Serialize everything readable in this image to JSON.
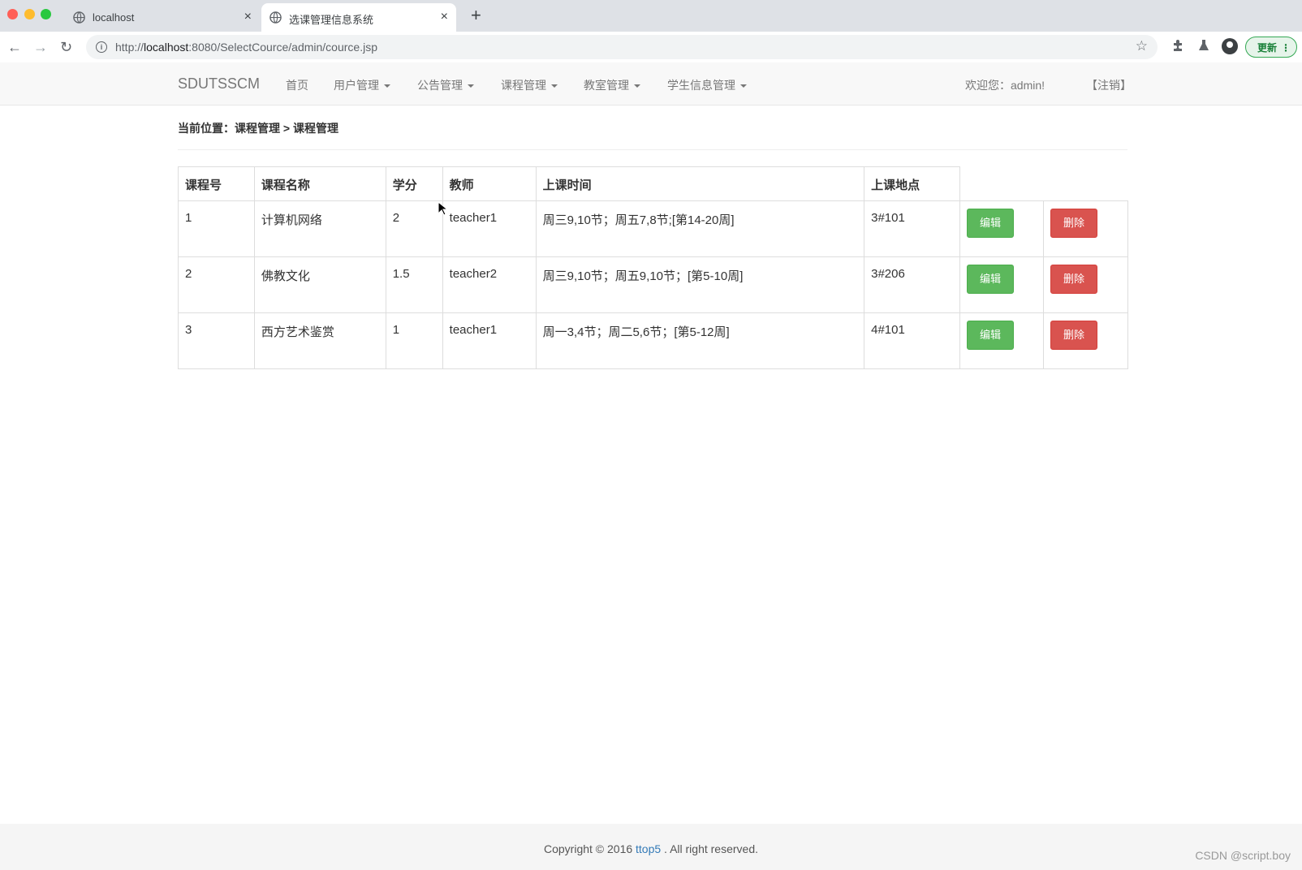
{
  "browser": {
    "tabs": [
      {
        "title": "localhost",
        "active": false
      },
      {
        "title": "选课管理信息系统",
        "active": true
      }
    ],
    "url_host": "localhost",
    "url_prefix": "http://",
    "url_suffix": ":8080/SelectCource/admin/cource.jsp",
    "update_label": "更新"
  },
  "navbar": {
    "brand": "SDUTSSCM",
    "menu": [
      "首页",
      "用户管理",
      "公告管理",
      "课程管理",
      "教室管理",
      "学生信息管理"
    ],
    "welcome": "欢迎您：admin!",
    "logout": "【注销】"
  },
  "breadcrumb": "当前位置：课程管理 > 课程管理",
  "table": {
    "headers": [
      "课程号",
      "课程名称",
      "学分",
      "教师",
      "上课时间",
      "上课地点"
    ],
    "edit_label": "编辑",
    "delete_label": "删除",
    "rows": [
      {
        "id": "1",
        "name": "计算机网络",
        "credit": "2",
        "teacher": "teacher1",
        "time": "周三9,10节；周五7,8节;[第14-20周]",
        "place": "3#101"
      },
      {
        "id": "2",
        "name": "佛教文化",
        "credit": "1.5",
        "teacher": "teacher2",
        "time": "周三9,10节；周五9,10节；[第5-10周]",
        "place": "3#206"
      },
      {
        "id": "3",
        "name": "西方艺术鉴赏",
        "credit": "1",
        "teacher": "teacher1",
        "time": "周一3,4节；周二5,6节；[第5-12周]",
        "place": "4#101"
      }
    ]
  },
  "footer": {
    "prefix": "Copyright © 2016 ",
    "link": "ttop5",
    "suffix": " . All right reserved.",
    "watermark": "CSDN @script.boy"
  },
  "colors": {
    "edit_button": "#5cb85c",
    "delete_button": "#d9534f",
    "link": "#337ab7"
  }
}
